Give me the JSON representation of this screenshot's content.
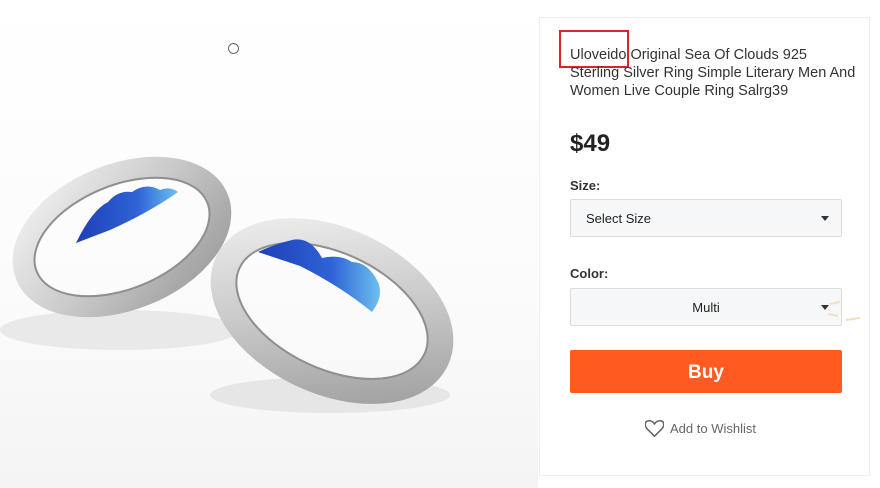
{
  "product": {
    "title": "Uloveido Original Sea Of Clouds 925 Sterling Silver Ring Simple Literary Men And Women Live Couple Ring Salrg39",
    "price": "$49"
  },
  "options": {
    "size_label": "Size:",
    "size_value": "Select Size",
    "color_label": "Color:",
    "color_value": "Multi"
  },
  "actions": {
    "buy_label": "Buy",
    "wishlist_label": "Add to Wishlist"
  },
  "icons": {
    "wishlist": "heart-outline-icon",
    "select": "caret-down-icon"
  },
  "colors": {
    "buy_button": "#ff5a1f",
    "highlight_box": "#d9252a",
    "ring_enamel": "#2f5fd0"
  }
}
